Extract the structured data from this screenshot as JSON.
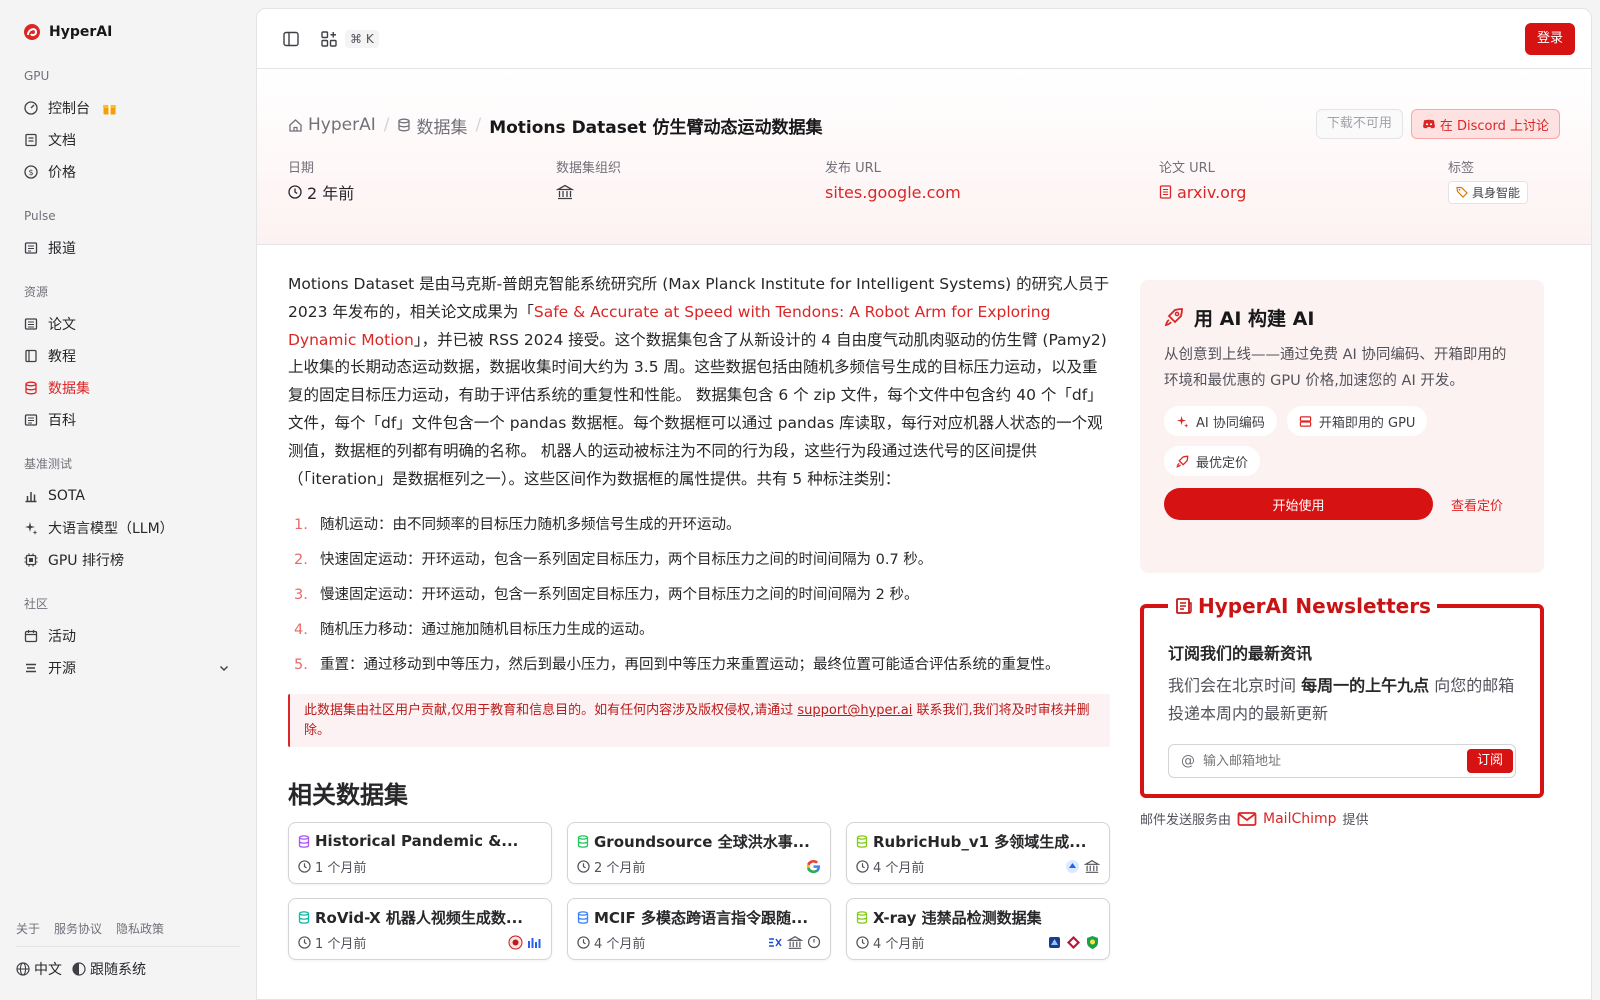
{
  "brand": {
    "name": "HyperAI",
    "color": "#dc2626"
  },
  "sidebar": {
    "groups": [
      {
        "label": "GPU",
        "items": [
          {
            "label": "控制台",
            "icon": "gauge-icon"
          },
          {
            "label": "文档",
            "icon": "book-icon"
          },
          {
            "label": "价格",
            "icon": "dollar-icon"
          }
        ]
      },
      {
        "label": "Pulse",
        "items": [
          {
            "label": "报道",
            "icon": "newspaper-icon"
          }
        ]
      },
      {
        "label": "资源",
        "items": [
          {
            "label": "论文",
            "icon": "paper-icon"
          },
          {
            "label": "教程",
            "icon": "notebook-icon"
          },
          {
            "label": "数据集",
            "icon": "database-icon",
            "active": true
          },
          {
            "label": "百科",
            "icon": "book-open-icon"
          }
        ]
      },
      {
        "label": "基准测试",
        "items": [
          {
            "label": "SOTA",
            "icon": "chart-icon"
          },
          {
            "label": "大语言模型（LLM）",
            "icon": "sparkle-icon"
          },
          {
            "label": "GPU 排行榜",
            "icon": "cpu-icon"
          }
        ]
      },
      {
        "label": "社区",
        "items": [
          {
            "label": "活动",
            "icon": "calendar-icon"
          },
          {
            "label": "开源",
            "icon": "list-icon"
          }
        ]
      }
    ],
    "footer_links": [
      "关于",
      "服务协议",
      "隐私政策"
    ],
    "language": "中文",
    "tracking": "跟随系统"
  },
  "topbar": {
    "shortcut": "⌘ K",
    "login": "登录"
  },
  "breadcrumb": {
    "home": "HyperAI",
    "section": "数据集",
    "current": "Motions Dataset 仿生臂动态运动数据集"
  },
  "hero_actions": {
    "download": "下载不可用",
    "discord": "在 Discord 上讨论"
  },
  "meta": {
    "date_label": "日期",
    "date_value": "2 年前",
    "org_label": "数据集组织",
    "url_label": "发布 URL",
    "url_value": "sites.google.com",
    "paper_label": "论文 URL",
    "paper_value": "arxiv.org",
    "tags_label": "标签",
    "tag": "具身智能"
  },
  "description": {
    "p1": "Motions Dataset 是由马克斯-普朗克智能系统研究所 (Max Planck Institute for Intelligent Systems) 的研究人员于 2023 年发布的，相关论文成果为「",
    "link": "Safe & Accurate at Speed with Tendons: A Robot Arm for Exploring Dynamic Motion",
    "p2": "」，并已被 RSS 2024 接受。这个数据集包含了从新设计的 4 自由度气动肌肉驱动的仿生臂 (Pamy2) 上收集的长期动态运动数据，数据收集时间大约为 3.5 周。这些数据包括由随机多频信号生成的目标压力运动，以及重复的固定目标压力运动，有助于评估系统的重复性和性能。 数据集包含 6 个 zip 文件，每个文件中包含约 40 个「df」文件，每个「df」文件包含一个 pandas 数据框。每个数据框可以通过 pandas 库读取，每行对应机器人状态的一个观测值，数据框的列都有明确的名称。 机器人的运动被标注为不同的行为段，这些行为段通过迭代号的区间提供（「iteration」是数据框列之一）。这些区间作为数据框的属性提供。共有 5 种标注类别："
  },
  "list": [
    {
      "num": "1.",
      "text": "随机运动：由不同频率的目标压力随机多频信号生成的开环运动。"
    },
    {
      "num": "2.",
      "text": "快速固定运动：开环运动，包含一系列固定目标压力，两个目标压力之间的时间间隔为 0.7 秒。"
    },
    {
      "num": "3.",
      "text": "慢速固定运动：开环运动，包含一系列固定目标压力，两个目标压力之间的时间间隔为 2 秒。"
    },
    {
      "num": "4.",
      "text": "随机压力移动：通过施加随机目标压力生成的运动。"
    },
    {
      "num": "5.",
      "text": "重置：通过移动到中等压力，然后到最小压力，再回到中等压力来重置运动；最终位置可能适合评估系统的重复性。"
    }
  ],
  "notice": {
    "before": "此数据集由社区用户贡献,仅用于教育和信息目的。如有任何内容涉及版权侵权,请通过 ",
    "email": "support@hyper.ai",
    "after": " 联系我们,我们将及时审核并删除。"
  },
  "related": {
    "title": "相关数据集",
    "cards": [
      {
        "title": "Historical Pandemic &...",
        "date": "1 个月前",
        "icon_color": "#a855f7"
      },
      {
        "title": "Groundsource 全球洪水事...",
        "date": "2 个月前",
        "icon_color": "#22c55e"
      },
      {
        "title": "RubricHub_v1 多领域生成...",
        "date": "4 个月前",
        "icon_color": "#84cc16"
      },
      {
        "title": "RoVid-X 机器人视频生成数...",
        "date": "1 个月前",
        "icon_color": "#14b8a6"
      },
      {
        "title": "MCIF 多模态跨语言指令跟随...",
        "date": "4 个月前",
        "icon_color": "#3b82f6"
      },
      {
        "title": "X-ray 违禁品检测数据集",
        "date": "4 个月前",
        "icon_color": "#84cc16"
      }
    ]
  },
  "promo": {
    "title": "用 AI 构建 AI",
    "desc": "从创意到上线——通过免费 AI 协同编码、开箱即用的环境和最优惠的 GPU 价格,加速您的 AI 开发。",
    "chips": [
      "AI 协同编码",
      "开箱即用的 GPU",
      "最优定价"
    ],
    "start": "开始使用",
    "pricing": "查看定价"
  },
  "newsletter": {
    "legend": "HyperAI Newsletters",
    "heading": "订阅我们的最新资讯",
    "p_before": "我们会在北京时间 ",
    "p_bold": "每周一的上午九点",
    "p_after": " 向您的邮箱投递本周内的最新更新",
    "placeholder": "输入邮箱地址",
    "subscribe": "订阅"
  },
  "mail_note": {
    "before": "邮件发送服务由",
    "brand": "MailChimp",
    "after": "提供"
  }
}
